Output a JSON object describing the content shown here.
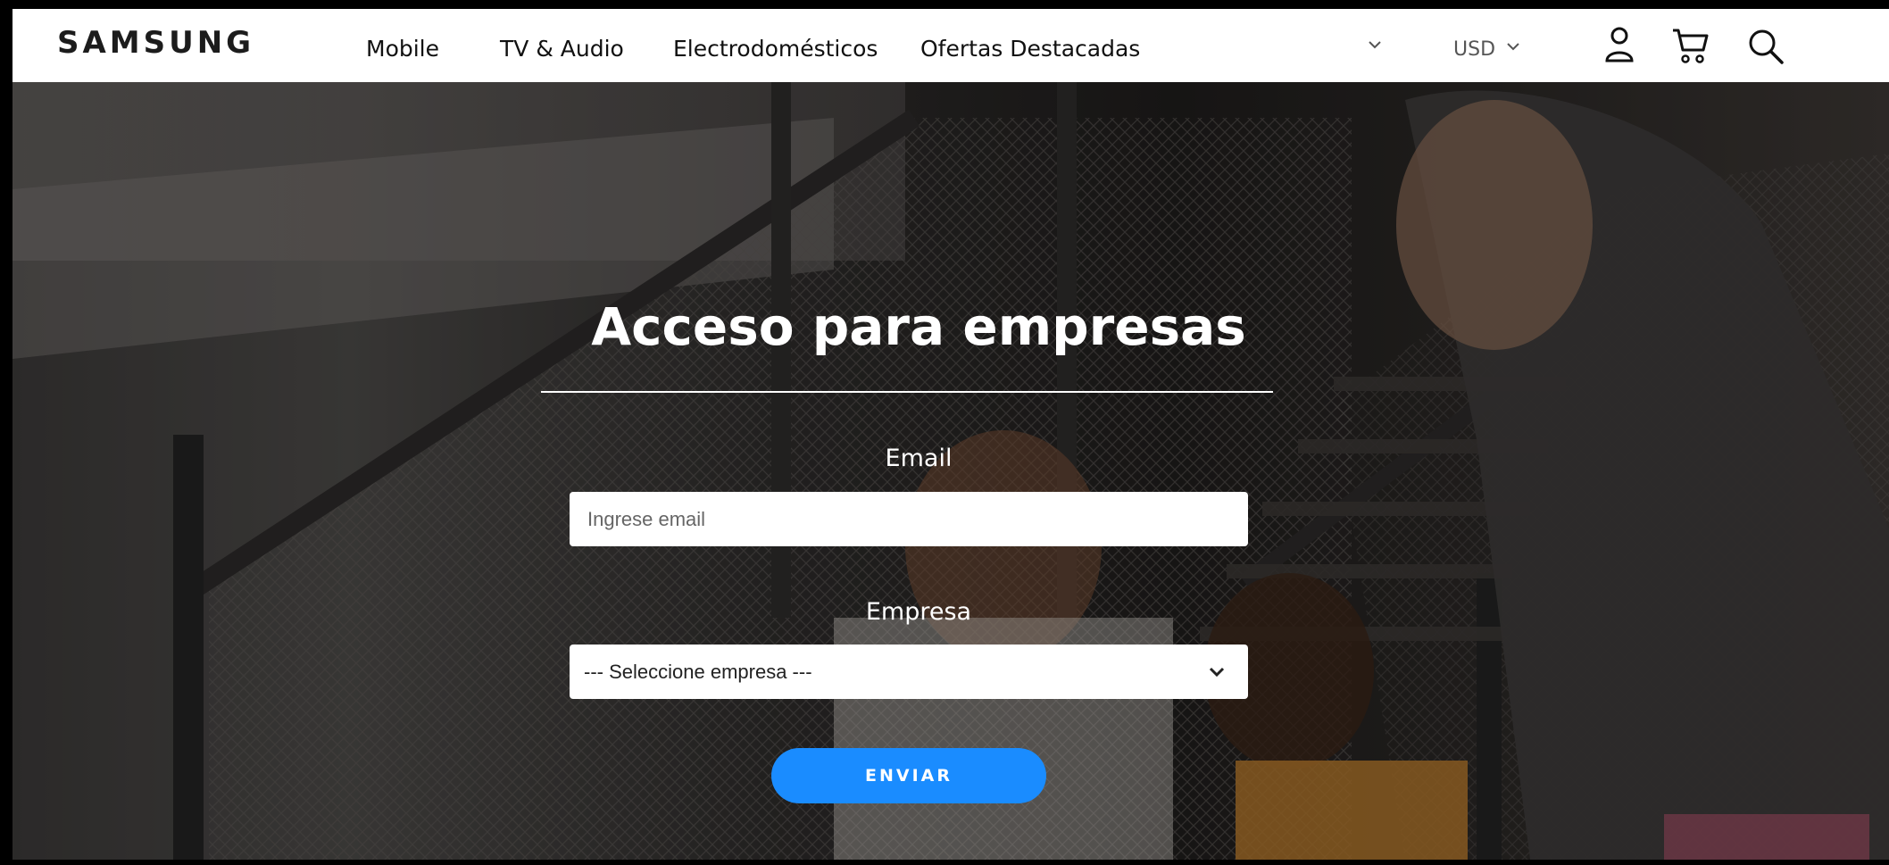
{
  "brand": {
    "logo_text": "SAMSUNG"
  },
  "nav": {
    "items": [
      {
        "label": "Mobile"
      },
      {
        "label": "TV & Audio"
      },
      {
        "label": "Electrodomésticos"
      },
      {
        "label": "Ofertas Destacadas"
      }
    ],
    "currency": "USD"
  },
  "icons": {
    "dropdown": "chevron-down-icon",
    "account": "user-icon",
    "cart": "cart-icon",
    "search": "search-icon"
  },
  "form": {
    "title": "Acceso para empresas",
    "email_label": "Email",
    "email_placeholder": "Ingrese email",
    "company_label": "Empresa",
    "company_selected": "--- Seleccione empresa ---",
    "submit_label": "ENVIAR"
  },
  "colors": {
    "accent": "#1a8cff",
    "header_bg": "#ffffff",
    "text_dark": "#111111"
  }
}
